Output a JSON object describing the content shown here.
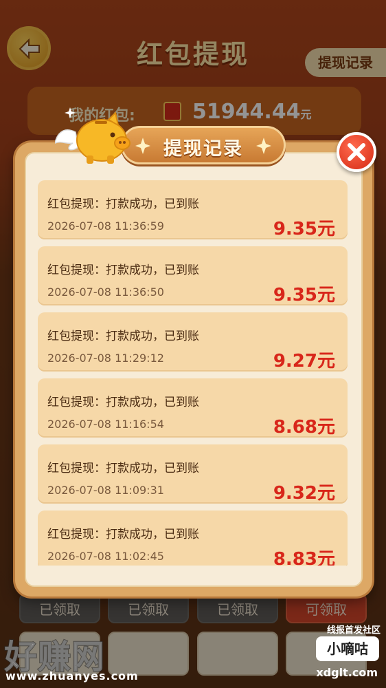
{
  "background": {
    "page_title": "红包提现",
    "record_link": "提现记录",
    "balance_label": "我的红包:",
    "balance_value": "51944.44",
    "balance_unit": "元",
    "bottom_buttons": [
      "已领取",
      "已领取",
      "已领取",
      "可领取"
    ]
  },
  "modal": {
    "title": "提现记录",
    "records": [
      {
        "desc": "红包提现：打款成功，已到账",
        "time": "2026-07-08 11:36:59",
        "amount": "9.35元"
      },
      {
        "desc": "红包提现：打款成功，已到账",
        "time": "2026-07-08 11:36:50",
        "amount": "9.35元"
      },
      {
        "desc": "红包提现：打款成功，已到账",
        "time": "2026-07-08 11:29:12",
        "amount": "9.27元"
      },
      {
        "desc": "红包提现：打款成功，已到账",
        "time": "2026-07-08 11:16:54",
        "amount": "8.68元"
      },
      {
        "desc": "红包提现：打款成功，已到账",
        "time": "2026-07-08 11:09:31",
        "amount": "9.32元"
      },
      {
        "desc": "红包提现：打款成功，已到账",
        "time": "2026-07-08 11:02:45",
        "amount": "8.83元"
      }
    ]
  },
  "watermarks": {
    "left_cn": "好赚网",
    "left_url": "www.zhuanyes.com",
    "right_top": "线报首发社区",
    "right_badge": "小嘀咕",
    "right_url": "xdglt.com"
  },
  "colors": {
    "amount": "#d8261a",
    "record_bg": "#f6d8a8",
    "modal_frame": "#dda865",
    "close": "#d52a14"
  }
}
